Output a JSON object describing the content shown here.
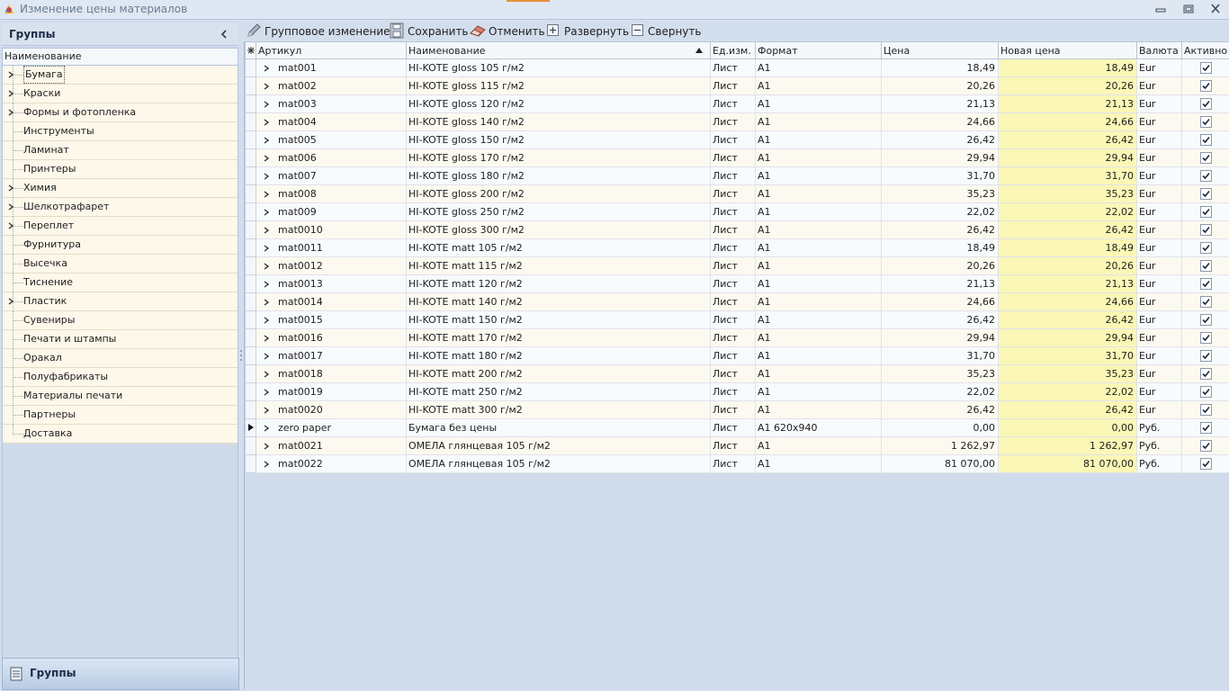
{
  "window": {
    "title": "Изменение цены материалов"
  },
  "sidebar": {
    "title": "Группы",
    "column_header": "Наименование",
    "items": [
      {
        "label": "Бумага",
        "expandable": true
      },
      {
        "label": "Краски",
        "expandable": true
      },
      {
        "label": "Формы и фотопленка",
        "expandable": true
      },
      {
        "label": "Инструменты",
        "expandable": false
      },
      {
        "label": "Ламинат",
        "expandable": false
      },
      {
        "label": "Принтеры",
        "expandable": false
      },
      {
        "label": "Химия",
        "expandable": true
      },
      {
        "label": "Шелкотрафарет",
        "expandable": true
      },
      {
        "label": "Переплет",
        "expandable": true
      },
      {
        "label": "Фурнитура",
        "expandable": false
      },
      {
        "label": "Высечка",
        "expandable": false
      },
      {
        "label": "Тиснение",
        "expandable": false
      },
      {
        "label": "Пластик",
        "expandable": true
      },
      {
        "label": "Сувениры",
        "expandable": false
      },
      {
        "label": "Печати и штампы",
        "expandable": false
      },
      {
        "label": "Оракал",
        "expandable": false
      },
      {
        "label": "Полуфабрикаты",
        "expandable": false
      },
      {
        "label": "Материалы печати",
        "expandable": false
      },
      {
        "label": "Партнеры",
        "expandable": false
      },
      {
        "label": "Доставка",
        "expandable": false
      }
    ],
    "footer_label": "Группы"
  },
  "toolbar": {
    "group_edit": "Групповое изменение",
    "save": "Сохранить",
    "cancel": "Отменить",
    "expand": "Развернуть",
    "collapse": "Свернуть"
  },
  "grid": {
    "columns": {
      "article": "Артикул",
      "name": "Наименование",
      "unit": "Ед.изм.",
      "format": "Формат",
      "price": "Цена",
      "new_price": "Новая цена",
      "currency": "Валюта",
      "active": "Активно"
    },
    "rows": [
      {
        "article": "mat001",
        "name": "HI-KOTE gloss 105 г/м2",
        "unit": "Лист",
        "format": "A1",
        "price": "18,49",
        "new_price": "18,49",
        "currency": "Eur",
        "active": true
      },
      {
        "article": "mat002",
        "name": "HI-KOTE gloss 115 г/м2",
        "unit": "Лист",
        "format": "A1",
        "price": "20,26",
        "new_price": "20,26",
        "currency": "Eur",
        "active": true
      },
      {
        "article": "mat003",
        "name": "HI-KOTE gloss 120 г/м2",
        "unit": "Лист",
        "format": "A1",
        "price": "21,13",
        "new_price": "21,13",
        "currency": "Eur",
        "active": true
      },
      {
        "article": "mat004",
        "name": "HI-KOTE gloss 140 г/м2",
        "unit": "Лист",
        "format": "A1",
        "price": "24,66",
        "new_price": "24,66",
        "currency": "Eur",
        "active": true
      },
      {
        "article": "mat005",
        "name": "HI-KOTE gloss 150 г/м2",
        "unit": "Лист",
        "format": "A1",
        "price": "26,42",
        "new_price": "26,42",
        "currency": "Eur",
        "active": true
      },
      {
        "article": "mat006",
        "name": "HI-KOTE gloss 170 г/м2",
        "unit": "Лист",
        "format": "A1",
        "price": "29,94",
        "new_price": "29,94",
        "currency": "Eur",
        "active": true
      },
      {
        "article": "mat007",
        "name": "HI-KOTE gloss 180 г/м2",
        "unit": "Лист",
        "format": "A1",
        "price": "31,70",
        "new_price": "31,70",
        "currency": "Eur",
        "active": true
      },
      {
        "article": "mat008",
        "name": "HI-KOTE gloss 200 г/м2",
        "unit": "Лист",
        "format": "A1",
        "price": "35,23",
        "new_price": "35,23",
        "currency": "Eur",
        "active": true
      },
      {
        "article": "mat009",
        "name": "HI-KOTE gloss 250 г/м2",
        "unit": "Лист",
        "format": "A1",
        "price": "22,02",
        "new_price": "22,02",
        "currency": "Eur",
        "active": true
      },
      {
        "article": "mat0010",
        "name": "HI-KOTE gloss 300 г/м2",
        "unit": "Лист",
        "format": "A1",
        "price": "26,42",
        "new_price": "26,42",
        "currency": "Eur",
        "active": true
      },
      {
        "article": "mat0011",
        "name": "HI-KOTE matt 105 г/м2",
        "unit": "Лист",
        "format": "A1",
        "price": "18,49",
        "new_price": "18,49",
        "currency": "Eur",
        "active": true
      },
      {
        "article": "mat0012",
        "name": "HI-KOTE matt 115 г/м2",
        "unit": "Лист",
        "format": "A1",
        "price": "20,26",
        "new_price": "20,26",
        "currency": "Eur",
        "active": true
      },
      {
        "article": "mat0013",
        "name": "HI-KOTE matt 120 г/м2",
        "unit": "Лист",
        "format": "A1",
        "price": "21,13",
        "new_price": "21,13",
        "currency": "Eur",
        "active": true
      },
      {
        "article": "mat0014",
        "name": "HI-KOTE matt 140 г/м2",
        "unit": "Лист",
        "format": "A1",
        "price": "24,66",
        "new_price": "24,66",
        "currency": "Eur",
        "active": true
      },
      {
        "article": "mat0015",
        "name": "HI-KOTE matt 150 г/м2",
        "unit": "Лист",
        "format": "A1",
        "price": "26,42",
        "new_price": "26,42",
        "currency": "Eur",
        "active": true
      },
      {
        "article": "mat0016",
        "name": "HI-KOTE matt 170 г/м2",
        "unit": "Лист",
        "format": "A1",
        "price": "29,94",
        "new_price": "29,94",
        "currency": "Eur",
        "active": true
      },
      {
        "article": "mat0017",
        "name": "HI-KOTE matt 180 г/м2",
        "unit": "Лист",
        "format": "A1",
        "price": "31,70",
        "new_price": "31,70",
        "currency": "Eur",
        "active": true
      },
      {
        "article": "mat0018",
        "name": "HI-KOTE matt 200 г/м2",
        "unit": "Лист",
        "format": "A1",
        "price": "35,23",
        "new_price": "35,23",
        "currency": "Eur",
        "active": true
      },
      {
        "article": "mat0019",
        "name": "HI-KOTE matt 250 г/м2",
        "unit": "Лист",
        "format": "A1",
        "price": "22,02",
        "new_price": "22,02",
        "currency": "Eur",
        "active": true
      },
      {
        "article": "mat0020",
        "name": "HI-KOTE matt 300 г/м2",
        "unit": "Лист",
        "format": "A1",
        "price": "26,42",
        "new_price": "26,42",
        "currency": "Eur",
        "active": true
      },
      {
        "article": "zero paper",
        "name": "Бумага без цены",
        "unit": "Лист",
        "format": "A1 620x940",
        "price": "0,00",
        "new_price": "0,00",
        "currency": "Руб.",
        "active": true,
        "current": true
      },
      {
        "article": "mat0021",
        "name": "ОМЕЛА глянцевая 105  г/м2",
        "unit": "Лист",
        "format": "A1",
        "price": "1 262,97",
        "new_price": "1 262,97",
        "currency": "Руб.",
        "active": true
      },
      {
        "article": "mat0022",
        "name": "ОМЕЛА глянцевая 105  г/м2",
        "unit": "Лист",
        "format": "A1",
        "price": "81 070,00",
        "new_price": "81 070,00",
        "currency": "Руб.",
        "active": true
      }
    ]
  },
  "colors": {
    "new_price_highlight": "#fbf7b6",
    "row_alt": "#fcfaf0",
    "title_accent": "#e8903a"
  }
}
